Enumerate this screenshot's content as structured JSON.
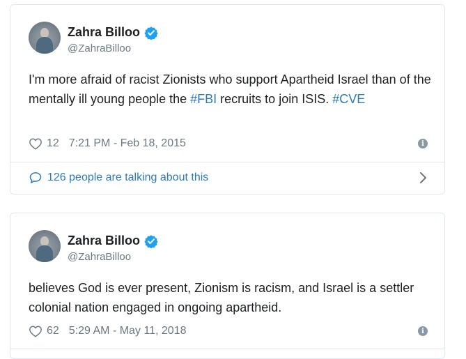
{
  "colors": {
    "link": "#2b7bb9",
    "muted": "#697882",
    "verified": "#1da1f2",
    "border": "#e1e8ed"
  },
  "tweets": [
    {
      "author_name": "Zahra Billoo",
      "handle": "@ZahraBilloo",
      "text_parts": [
        {
          "text": "I'm more afraid of racist Zionists who support Apartheid Israel than of the mentally ill young people the ",
          "link": false
        },
        {
          "text": "#FBI",
          "link": true
        },
        {
          "text": " recruits to join ISIS. ",
          "link": false
        },
        {
          "text": "#CVE",
          "link": true
        }
      ],
      "likes": "12",
      "timestamp": "7:21 PM - Feb 18, 2015",
      "talking": "126 people are talking about this"
    },
    {
      "author_name": "Zahra Billoo",
      "handle": "@ZahraBilloo",
      "text_parts": [
        {
          "text": "believes God is ever present, Zionism is racism, and Israel is a settler colonial nation engaged in ongoing apartheid.",
          "link": false
        }
      ],
      "likes": "62",
      "timestamp": "5:29 AM - May 11, 2018"
    }
  ],
  "icons": {
    "verified": "verified-badge-icon",
    "like": "heart-icon",
    "info": "info-icon",
    "talk": "speech-bubble-icon",
    "chevron": "chevron-right-icon"
  }
}
